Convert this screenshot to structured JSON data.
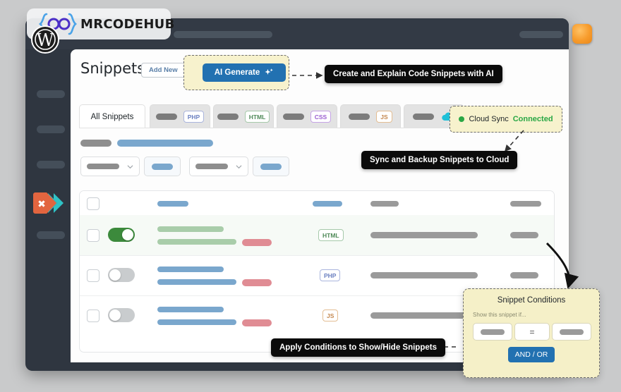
{
  "watermark": {
    "brand": "MRCODEHUB",
    "logo_icon": "braces-oo-icon",
    "cms_icon": "wordpress-icon"
  },
  "window": {
    "topbar": {
      "account_icon": "orange-avatar-button"
    },
    "sidebar": {
      "items": [
        "menu-item-1",
        "menu-item-2",
        "menu-item-3",
        "menu-item-4"
      ],
      "logo_icon": "snippets-play-logo-icon"
    }
  },
  "header": {
    "title": "Snippets",
    "add_new_label": "Add New",
    "ai_generate_label": "AI Generate",
    "ai_icon": "sparkle-icon"
  },
  "tabs": [
    {
      "label": "All Snippets",
      "badge": "",
      "active": true
    },
    {
      "label": "",
      "badge": "PHP",
      "active": false
    },
    {
      "label": "",
      "badge": "HTML",
      "active": false
    },
    {
      "label": "",
      "badge": "CSS",
      "active": false
    },
    {
      "label": "",
      "badge": "JS",
      "active": false
    },
    {
      "label": "",
      "badge": "cloud-icon",
      "active": false
    }
  ],
  "cloud_sync": {
    "label": "Cloud Sync",
    "status": "Connected",
    "status_color": "#29a745",
    "dot_icon": "status-dot-icon"
  },
  "callouts": {
    "ai": "Create and Explain Code Snippets with AI",
    "cloud": "Sync and Backup Snippets to Cloud",
    "conditions": "Apply Conditions to Show/Hide Snippets"
  },
  "filters": {
    "dropdown_1": "",
    "dropdown_2": "",
    "button_1": "",
    "button_2": "",
    "chevron_icon": "chevron-down-icon"
  },
  "table": {
    "header": {
      "select_all": "checkbox-icon",
      "columns": [
        "",
        "",
        "",
        ""
      ]
    },
    "rows": [
      {
        "enabled": true,
        "language": "HTML",
        "toggle_state": "on"
      },
      {
        "enabled": false,
        "language": "PHP",
        "toggle_state": "off"
      },
      {
        "enabled": false,
        "language": "JS",
        "toggle_state": "off"
      }
    ]
  },
  "conditions_panel": {
    "title": "Snippet Conditions",
    "subtitle": "Show this snippet if...",
    "field_1": "",
    "operator": "=",
    "field_3": "",
    "and_or_label": "AND / OR"
  },
  "colors": {
    "accent_blue": "#2271b1",
    "highlight_yellow": "#f5f0c8",
    "toggle_green": "#3c8a3c",
    "badge_php": "#6a7fc0",
    "badge_html": "#4f8a58",
    "badge_css": "#9b5fd0",
    "badge_js": "#c4884f",
    "orange": "#f79b2b"
  }
}
